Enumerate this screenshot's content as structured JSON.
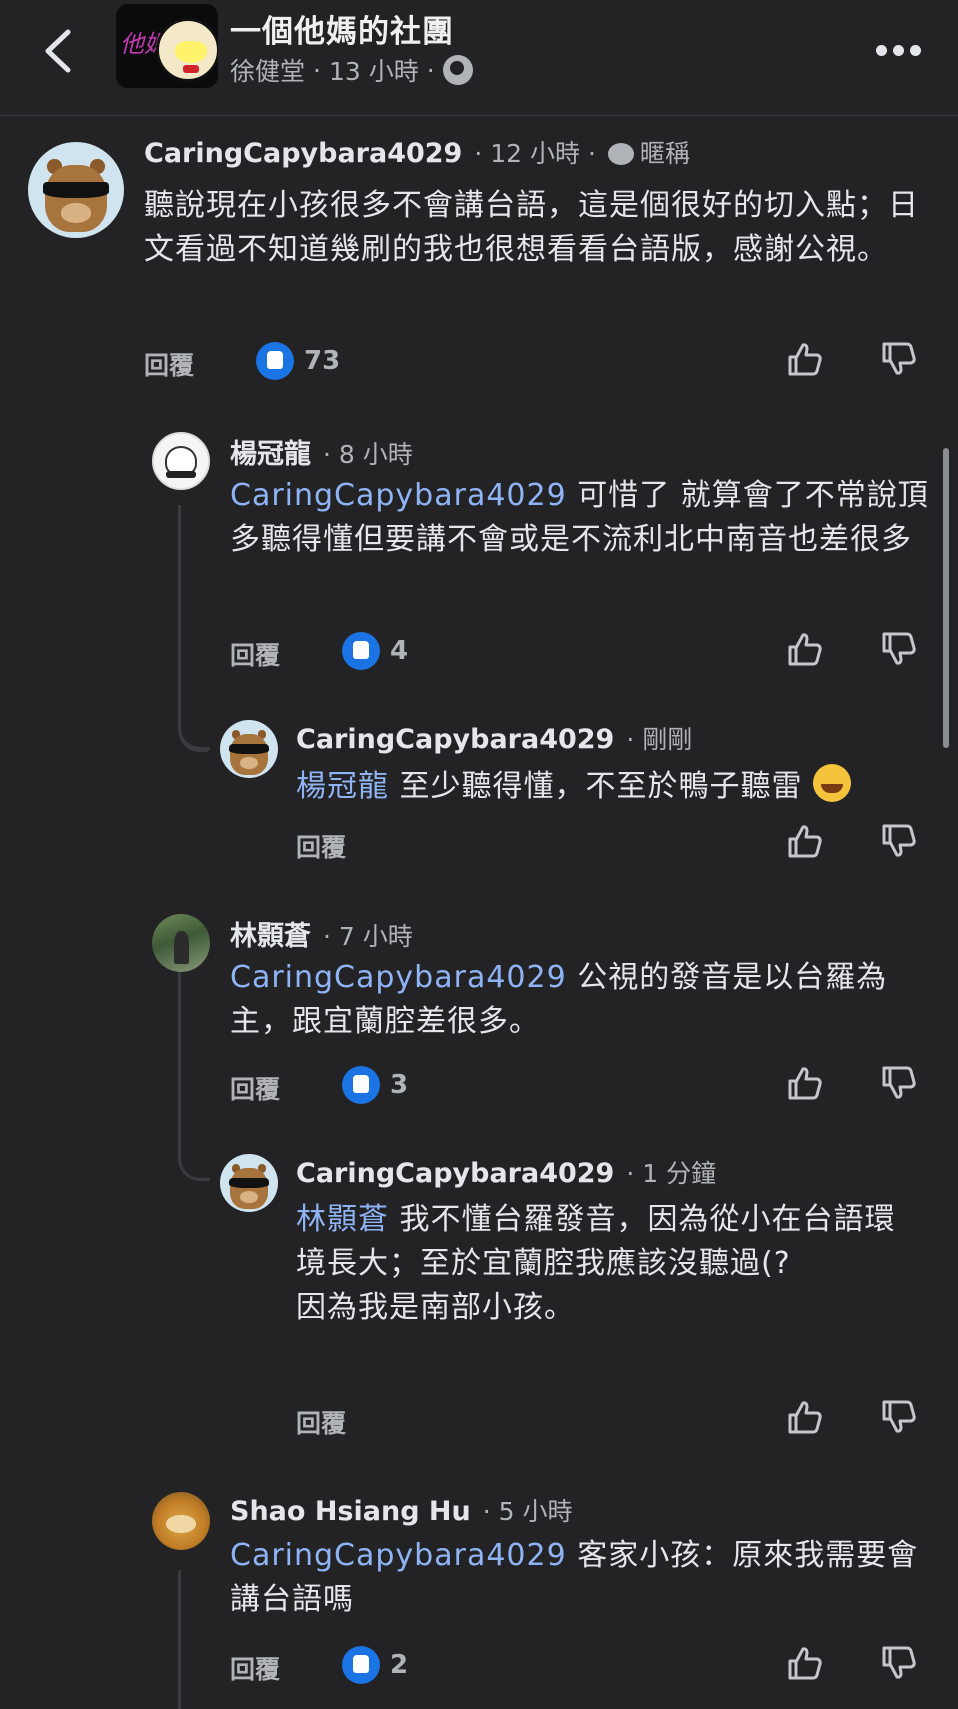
{
  "header": {
    "group_name": "一個他媽的社團",
    "author": "徐健堂",
    "time": "13 小時",
    "sep": "·",
    "logo_text": "他媽"
  },
  "comments": [
    {
      "author": "CaringCapybara4029",
      "time": "· 12 小時 ·",
      "tag": "暱稱",
      "text": "聽說現在小孩很多不會講台語，這是個很好的切入點；日文看過不知道幾刷的我也很想看看台語版，感謝公視。",
      "reply": "回覆",
      "likes": "73"
    },
    {
      "author": "楊冠龍",
      "time": "· 8 小時",
      "mention": "CaringCapybara4029",
      "text": " 可惜了 就算會了不常說頂多聽得懂但要講不會或是不流利北中南音也差很多",
      "reply": "回覆",
      "likes": "4"
    },
    {
      "author": "CaringCapybara4029",
      "time": "· 剛剛",
      "mention": "楊冠龍",
      "text": " 至少聽得懂，不至於鴨子聽雷",
      "reply": "回覆"
    },
    {
      "author": "林顥蒼",
      "time": "· 7 小時",
      "mention": "CaringCapybara4029",
      "text": " 公視的發音是以台羅為主，跟宜蘭腔差很多。",
      "reply": "回覆",
      "likes": "3"
    },
    {
      "author": "CaringCapybara4029",
      "time": "· 1 分鐘",
      "mention": "林顥蒼",
      "text": " 我不懂台羅發音，因為從小在台語環境長大；至於宜蘭腔我應該沒聽過(?",
      "text2": "因為我是南部小孩。",
      "reply": "回覆"
    },
    {
      "author": "Shao Hsiang Hu",
      "time": "· 5 小時",
      "mention": "CaringCapybara4029",
      "text": " 客家小孩：原來我需要會講台語嗎",
      "reply": "回覆",
      "likes": "2"
    }
  ],
  "icons": {
    "back": "chevron-left-icon",
    "more": "more-icon",
    "like": "thumbs-up-icon",
    "dislike": "thumbs-down-icon",
    "globe": "globe-icon",
    "emoji": "rolling-laughing-emoji"
  },
  "colors": {
    "background": "#232326",
    "mention": "#8fb4f5",
    "like_badge": "#1b74e4"
  }
}
